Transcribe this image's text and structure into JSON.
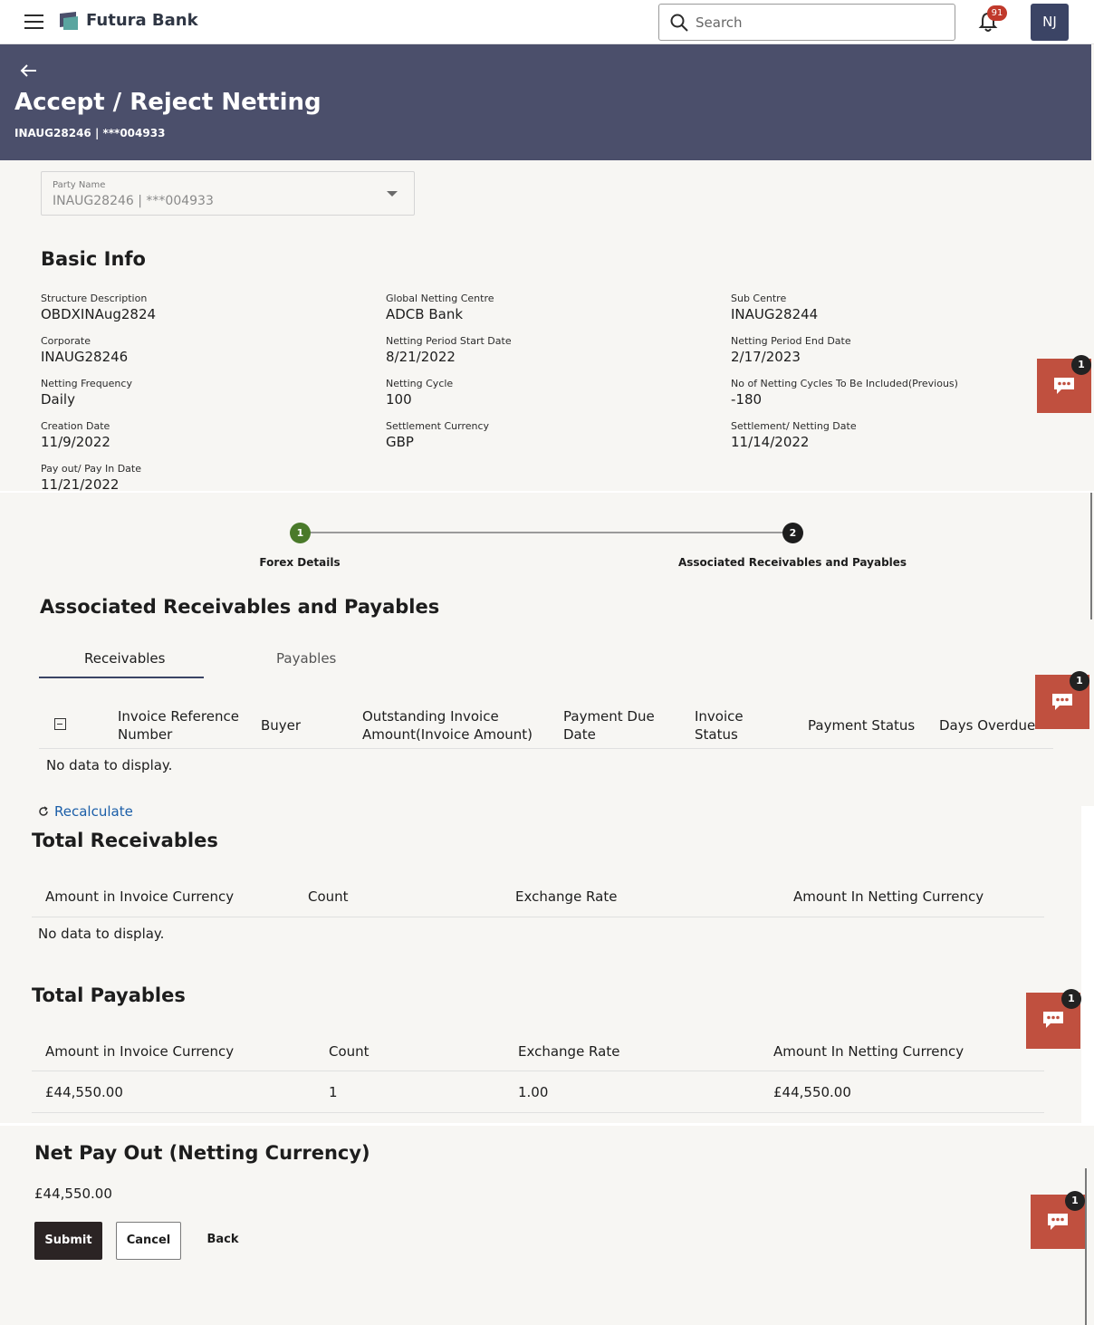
{
  "app": {
    "brand": "Futura Bank",
    "search_placeholder": "Search",
    "notification_count": "91",
    "user_initials": "NJ"
  },
  "header": {
    "title": "Accept / Reject Netting",
    "subtitle": "INAUG28246 | ***004933"
  },
  "party": {
    "label": "Party Name",
    "value": "INAUG28246 | ***004933"
  },
  "basic_info": {
    "title": "Basic Info",
    "fields": [
      {
        "label": "Structure Description",
        "value": "OBDXINAug2824"
      },
      {
        "label": "Global Netting Centre",
        "value": "ADCB Bank"
      },
      {
        "label": "Sub Centre",
        "value": "INAUG28244"
      },
      {
        "label": "Corporate",
        "value": "INAUG28246"
      },
      {
        "label": "Netting Period Start Date",
        "value": "8/21/2022"
      },
      {
        "label": "Netting Period End Date",
        "value": "2/17/2023"
      },
      {
        "label": "Netting Frequency",
        "value": "Daily"
      },
      {
        "label": "Netting Cycle",
        "value": "100"
      },
      {
        "label": "No of Netting Cycles To Be Included(Previous)",
        "value": "-180"
      },
      {
        "label": "Creation Date",
        "value": "11/9/2022"
      },
      {
        "label": "Settlement Currency",
        "value": "GBP"
      },
      {
        "label": "Settlement/ Netting Date",
        "value": "11/14/2022"
      },
      {
        "label": "Pay out/ Pay In Date",
        "value": "11/21/2022"
      }
    ]
  },
  "stepper": {
    "steps": [
      {
        "number": "1",
        "label": "Forex Details"
      },
      {
        "number": "2",
        "label": "Associated Receivables and Payables"
      }
    ]
  },
  "associated": {
    "title": "Associated Receivables and Payables",
    "tabs": [
      "Receivables",
      "Payables"
    ],
    "columns": [
      "Invoice Reference Number",
      "Buyer",
      "Outstanding Invoice Amount(Invoice Amount)",
      "Payment Due Date",
      "Invoice Status",
      "Payment Status",
      "Days Overdue"
    ],
    "empty_text": "No data to display.",
    "recalculate_label": "Recalculate"
  },
  "total_receivables": {
    "title": "Total Receivables",
    "columns": [
      "Amount in Invoice Currency",
      "Count",
      "Exchange Rate",
      "Amount In Netting Currency"
    ],
    "empty_text": "No data to display."
  },
  "total_payables": {
    "title": "Total Payables",
    "columns": [
      "Amount in Invoice Currency",
      "Count",
      "Exchange Rate",
      "Amount In Netting Currency"
    ],
    "rows": [
      [
        "£44,550.00",
        "1",
        "1.00",
        "£44,550.00"
      ]
    ]
  },
  "net_payout": {
    "title": "Net Pay Out (Netting Currency)",
    "value": "£44,550.00"
  },
  "actions": {
    "submit": "Submit",
    "cancel": "Cancel",
    "back": "Back"
  },
  "chat": {
    "badge": "1"
  },
  "colors": {
    "header_band": "#4b4f6b",
    "step_complete": "#4a7a2a",
    "step_current": "#1d1d1d",
    "chat_widget": "#c0503f",
    "link": "#1b5ea8"
  }
}
